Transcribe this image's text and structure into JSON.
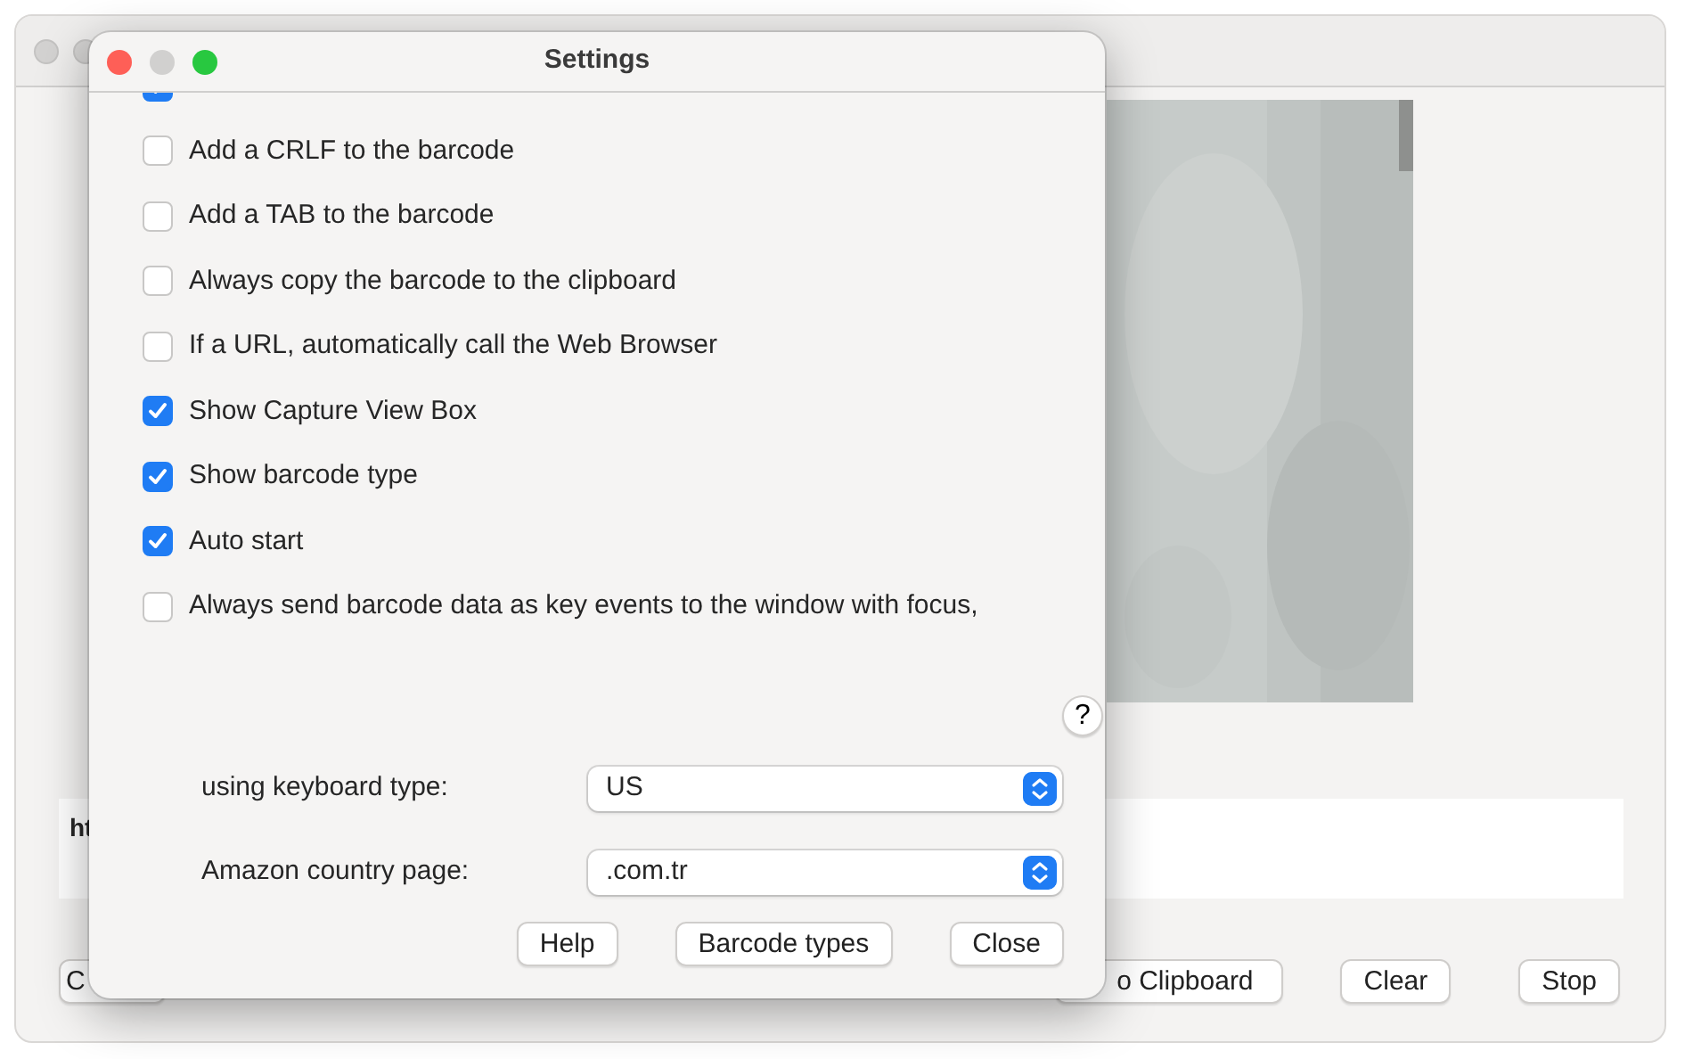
{
  "background_window": {
    "text_field": {
      "value": "ht"
    },
    "buttons": [
      "C",
      "o Clipboard",
      "Clear",
      "Stop"
    ]
  },
  "settings": {
    "title": "Settings",
    "options": [
      {
        "checked": true
      },
      {
        "label": "Add a CRLF to the barcode",
        "checked": false
      },
      {
        "label": "Add a TAB to the barcode",
        "checked": false
      },
      {
        "label": "Always copy the barcode to the clipboard",
        "checked": false
      },
      {
        "label": "If a URL, automatically call the Web Browser",
        "checked": false
      },
      {
        "label": "Show Capture View Box",
        "checked": true
      },
      {
        "label": "Show barcode type",
        "checked": true
      },
      {
        "label": "Auto start",
        "checked": true
      },
      {
        "label": "Always send barcode data as key events to the window with focus,",
        "checked": false
      }
    ],
    "help_button": "?",
    "fields": [
      {
        "label": "using keyboard type:",
        "value": "US"
      },
      {
        "label": "Amazon country page:",
        "value": ".com.tr"
      }
    ],
    "buttons": [
      "Help",
      "Barcode types",
      "Close"
    ]
  }
}
